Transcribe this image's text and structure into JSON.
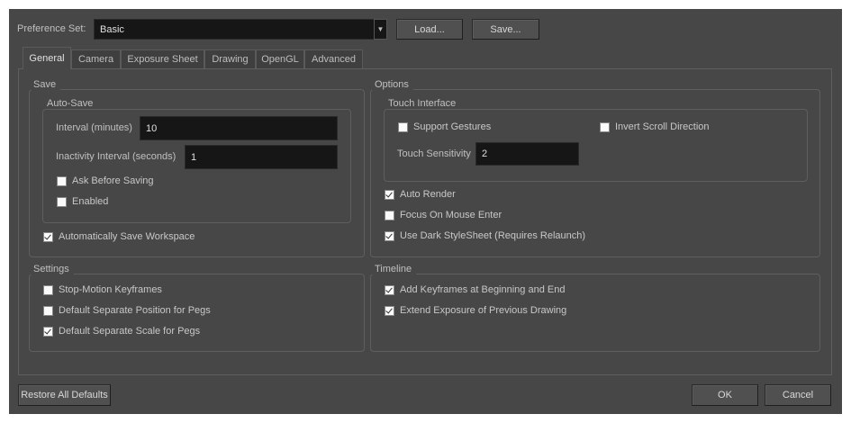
{
  "preference_set": {
    "label": "Preference Set:",
    "value": "Basic",
    "load": "Load...",
    "save": "Save..."
  },
  "tabs": [
    "General",
    "Camera",
    "Exposure Sheet",
    "Drawing",
    "OpenGL",
    "Advanced"
  ],
  "save": {
    "title": "Save",
    "autosave_title": "Auto-Save",
    "interval_label": "Interval (minutes)",
    "interval_value": "10",
    "inactivity_label": "Inactivity Interval (seconds)",
    "inactivity_value": "1",
    "ask": "Ask Before Saving",
    "enabled": "Enabled",
    "workspace": "Automatically Save Workspace"
  },
  "settings": {
    "title": "Settings",
    "items": [
      "Stop-Motion Keyframes",
      "Default Separate Position for Pegs",
      "Default Separate Scale for Pegs"
    ]
  },
  "options": {
    "title": "Options",
    "touch_title": "Touch Interface",
    "support_gestures": "Support Gestures",
    "invert_scroll": "Invert Scroll Direction",
    "touch_sensitivity_label": "Touch Sensitivity",
    "touch_sensitivity_value": "2",
    "items": [
      "Auto Render",
      "Focus On Mouse Enter",
      "Use Dark StyleSheet (Requires Relaunch)"
    ]
  },
  "timeline": {
    "title": "Timeline",
    "items": [
      "Add Keyframes at Beginning and End",
      "Extend Exposure of Previous Drawing"
    ]
  },
  "footer": {
    "restore": "Restore All Defaults",
    "ok": "OK",
    "cancel": "Cancel"
  }
}
